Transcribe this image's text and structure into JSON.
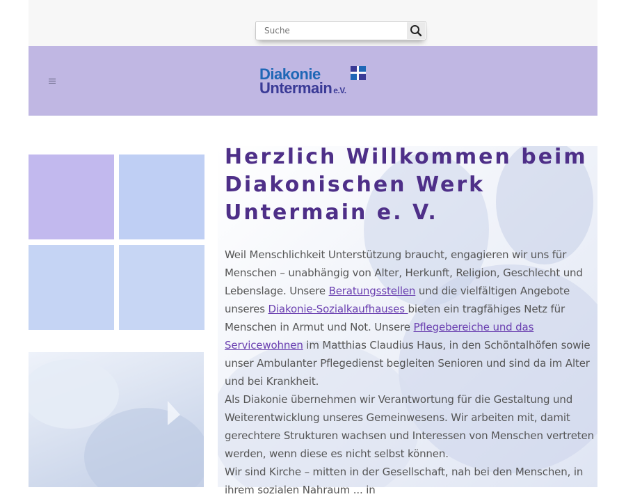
{
  "search": {
    "placeholder": "Suche",
    "icon": "search-icon"
  },
  "header": {
    "menu_icon": "hamburger-icon",
    "logo": {
      "line1": "Diakonie",
      "line2": "Untermain",
      "suffix": "e.V."
    }
  },
  "main": {
    "title": "Herzlich Willkommen beim Diakonischen Werk Untermain e. V.",
    "p1": {
      "t1": "Weil Menschlichkeit Unterstützung braucht, engagieren wir uns für Menschen – unabhängig von Alter, Herkunft, Religion, Geschlecht und Lebenslage. Unsere ",
      "link1": "Beratungsstellen",
      "t2": " und die vielfältigen Angebote unseres ",
      "link2": "Diakonie-Sozialkaufhauses ",
      "t3": " bieten ein tragfähiges Netz für Menschen in Armut und Not. Unsere ",
      "link3": "Pflegebereiche und das Servicewohnen",
      "t4": " im Matthias Claudius Haus, in den Schöntalhöfen sowie unser Ambulanter Pflegedienst begleiten Senioren und sind da im Alter und bei Krankheit."
    },
    "p2": "Als Diakonie übernehmen wir Verantwortung für die Gestaltung und Weiterentwicklung unseres Gemeinwesens. Wir arbeiten mit, damit gerechtere Strukturen wachsen und Interessen von Menschen vertreten werden, wenn diese es nicht selbst können.",
    "p3": "Wir sind Kirche – mitten in der Gesellschaft, nah bei den Menschen, in ihrem sozialen Nahraum ... in"
  },
  "colors": {
    "title": "#4e2f88",
    "header_bg": "#c0b7e3",
    "link": "#6a3fb0",
    "logo_blue": "#1f67b6",
    "logo_purple": "#3a3a96"
  }
}
